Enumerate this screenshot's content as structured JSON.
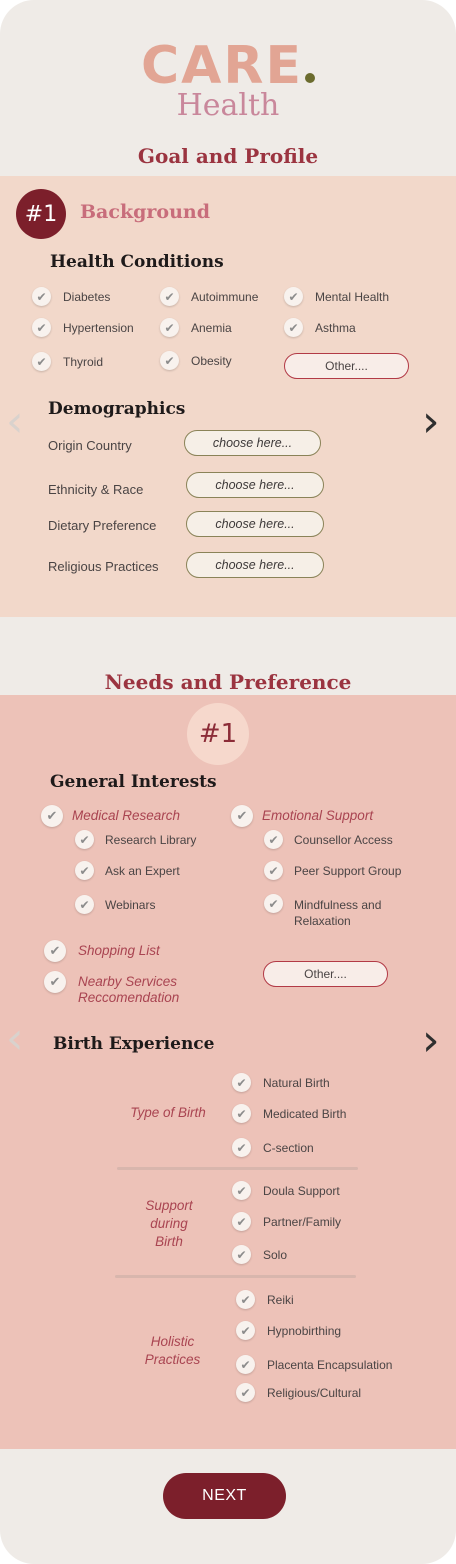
{
  "logo": {
    "brand": "CARE",
    "sub": "Health"
  },
  "section1": {
    "title": "Goal and Profile",
    "step": "#1",
    "step_label": "Background",
    "health": {
      "heading": "Health Conditions",
      "items": [
        "Diabetes",
        "Autoimmune",
        "Mental Health",
        "Hypertension",
        "Anemia",
        "Asthma",
        "Thyroid",
        "Obesity"
      ],
      "other": "Other...."
    },
    "demo": {
      "heading": "Demographics",
      "fields": [
        {
          "label": "Origin Country",
          "value": "choose here..."
        },
        {
          "label": "Ethnicity & Race",
          "value": "choose here..."
        },
        {
          "label": "Dietary Preference",
          "value": "choose here..."
        },
        {
          "label": "Religious Practices",
          "value": "choose here..."
        }
      ]
    }
  },
  "section2": {
    "title": "Needs and Preference",
    "step": "#1",
    "interests": {
      "heading": "General Interests",
      "medical": "Medical Research",
      "medical_items": [
        "Research Library",
        "Ask an Expert",
        "Webinars"
      ],
      "emotional": "Emotional Support",
      "emotional_items": [
        "Counsellor Access",
        "Peer Support Group",
        "Mindfulness and Relaxation"
      ],
      "shopping": "Shopping List",
      "nearby": "Nearby Services Reccomendation",
      "other": "Other...."
    },
    "birth": {
      "heading": "Birth Experience",
      "groups": [
        {
          "label": "Type of Birth",
          "items": [
            "Natural Birth",
            "Medicated Birth",
            "C-section"
          ]
        },
        {
          "label": "Support during Birth",
          "items": [
            "Doula Support",
            "Partner/Family",
            "Solo"
          ]
        },
        {
          "label": "Holistic Practices",
          "items": [
            "Reiki",
            "Hypnobirthing",
            "Placenta Encapsulation",
            "Religious/Cultural"
          ]
        }
      ]
    }
  },
  "next": "NEXT",
  "icons": {
    "check": "check-icon",
    "prev": "chevron-left-icon",
    "next": "chevron-right-icon"
  },
  "colors": {
    "brand": "#7c1f2b",
    "panel1": "#f2d8ca",
    "panel2": "#edc2b8",
    "accent_text": "#a94451"
  }
}
